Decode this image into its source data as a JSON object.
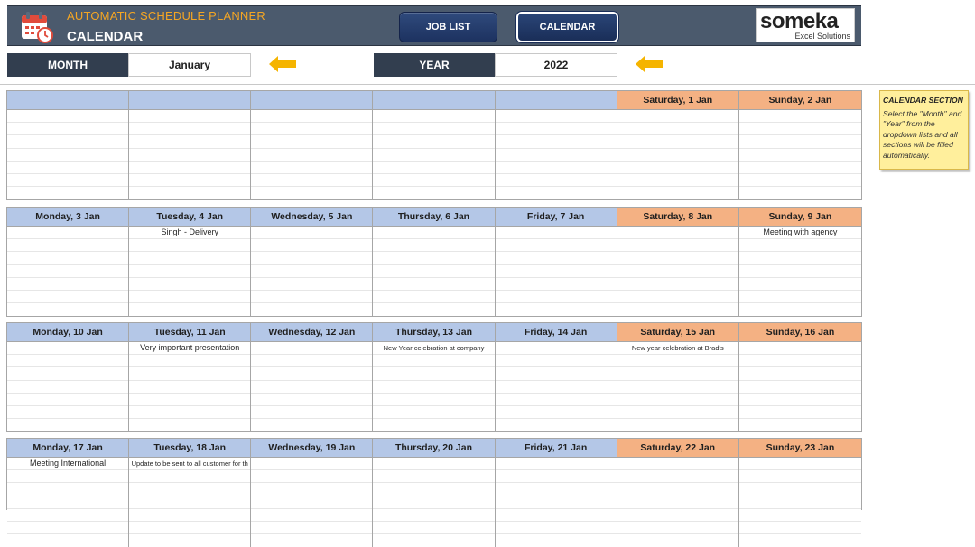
{
  "header": {
    "app_title": "AUTOMATIC SCHEDULE PLANNER",
    "page_title": "CALENDAR",
    "job_list_label": "JOB LIST",
    "calendar_label": "CALENDAR",
    "logo_main": "someka",
    "logo_sub": "Excel Solutions"
  },
  "selectors": {
    "month_label": "MONTH",
    "month_value": "January",
    "year_label": "YEAR",
    "year_value": "2022"
  },
  "colors": {
    "weekday_header": "#b4c7e7",
    "weekend_header": "#f4b183",
    "arrow": "#f5b400",
    "topbar": "#4b5a6d"
  },
  "note": {
    "title": "CALENDAR SECTION",
    "text": "Select the \"Month\" and \"Year\" from the dropdown lists and all sections will be filled automatically."
  },
  "weeks": [
    {
      "days": [
        "",
        "",
        "",
        "",
        "",
        "Saturday, 1 Jan",
        "Sunday, 2 Jan"
      ],
      "events": [
        [
          ""
        ],
        [
          ""
        ],
        [
          ""
        ],
        [
          ""
        ],
        [
          ""
        ],
        [
          ""
        ],
        [
          ""
        ]
      ]
    },
    {
      "days": [
        "Monday, 3 Jan",
        "Tuesday, 4 Jan",
        "Wednesday, 5 Jan",
        "Thursday, 6 Jan",
        "Friday, 7 Jan",
        "Saturday, 8 Jan",
        "Sunday, 9 Jan"
      ],
      "events": [
        [
          ""
        ],
        [
          "Singh - Delivery"
        ],
        [
          ""
        ],
        [
          ""
        ],
        [
          ""
        ],
        [
          ""
        ],
        [
          "Meeting with agency"
        ]
      ]
    },
    {
      "days": [
        "Monday, 10 Jan",
        "Tuesday, 11 Jan",
        "Wednesday, 12 Jan",
        "Thursday, 13 Jan",
        "Friday, 14 Jan",
        "Saturday, 15 Jan",
        "Sunday, 16 Jan"
      ],
      "events": [
        [
          ""
        ],
        [
          "Very important presentation"
        ],
        [
          ""
        ],
        [
          "New Year celebration at company"
        ],
        [
          ""
        ],
        [
          "New year celebration at Brad's"
        ],
        [
          ""
        ]
      ]
    },
    {
      "days": [
        "Monday, 17 Jan",
        "Tuesday, 18 Jan",
        "Wednesday, 19 Jan",
        "Thursday, 20 Jan",
        "Friday, 21 Jan",
        "Saturday, 22 Jan",
        "Sunday, 23 Jan"
      ],
      "events": [
        [
          "Meeting International"
        ],
        [
          "Update to be sent to all customer for th"
        ],
        [
          ""
        ],
        [
          ""
        ],
        [
          ""
        ],
        [
          ""
        ],
        [
          ""
        ]
      ]
    }
  ]
}
